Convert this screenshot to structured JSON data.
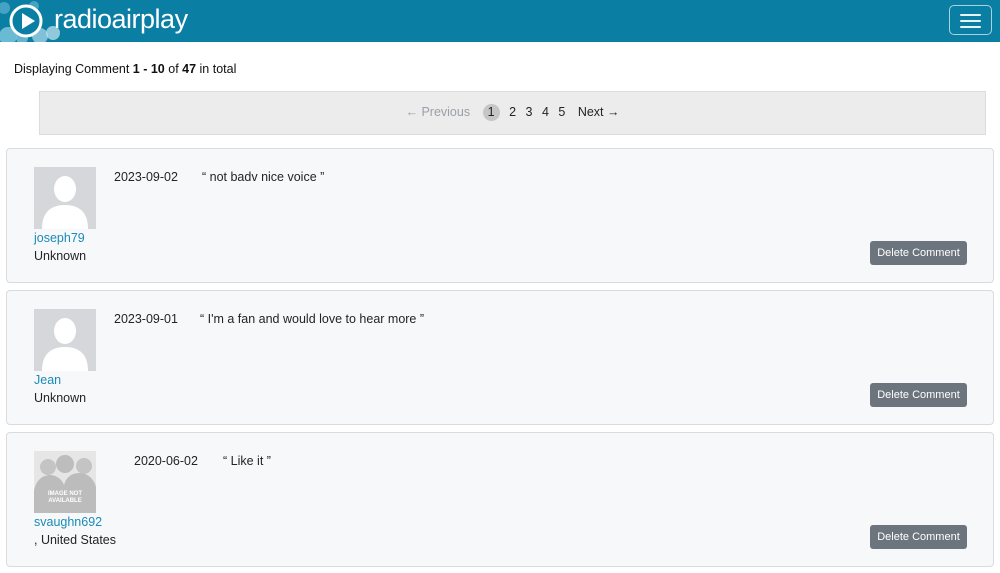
{
  "header": {
    "logo_text": "radioairplay",
    "menu_icon": "hamburger-menu-icon"
  },
  "summary": {
    "prefix": "Displaying Comment ",
    "range": "1 - 10",
    "middle": " of ",
    "total": "47",
    "suffix": " in total"
  },
  "pagination": {
    "previous": "← Previous",
    "pages": [
      "1",
      "2",
      "3",
      "4",
      "5"
    ],
    "current": "1",
    "next": "Next →"
  },
  "comments": [
    {
      "username": "joseph79",
      "location": "Unknown",
      "date": "2023-09-02",
      "text": "“ not badv nice voice ”",
      "avatar": "default-user-avatar",
      "delete_label": "Delete Comment"
    },
    {
      "username": "Jean",
      "location": "Unknown",
      "date": "2023-09-01",
      "text": "“ I'm a fan and would love to hear more ”",
      "avatar": "default-user-avatar",
      "delete_label": "Delete Comment"
    },
    {
      "username": "svaughn692",
      "location": ", United States",
      "date": "2020-06-02",
      "text": "“ Like it ”",
      "avatar": "image-not-available",
      "avatar_text": "IMAGE NOT AVAILABLE",
      "delete_label": "Delete Comment"
    }
  ]
}
